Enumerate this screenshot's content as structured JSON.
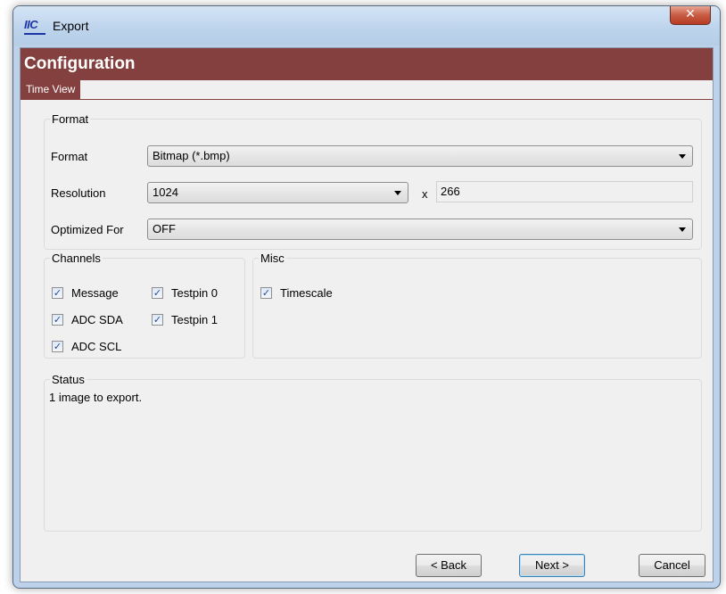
{
  "window": {
    "title": "Export",
    "app_icon_text": "IIC",
    "close_glyph": "✕"
  },
  "header": {
    "title": "Configuration",
    "tab": "Time View"
  },
  "format_group": {
    "legend": "Format",
    "format_label": "Format",
    "format_value": "Bitmap (*.bmp)",
    "resolution_label": "Resolution",
    "resolution_width": "1024",
    "resolution_sep": "x",
    "resolution_height": "266",
    "optimized_label": "Optimized For",
    "optimized_value": "OFF"
  },
  "channels_group": {
    "legend": "Channels",
    "items": [
      {
        "label": "Message",
        "checked": true
      },
      {
        "label": "Testpin 0",
        "checked": true
      },
      {
        "label": "ADC SDA",
        "checked": true
      },
      {
        "label": "Testpin 1",
        "checked": true
      },
      {
        "label": "ADC SCL",
        "checked": true
      }
    ]
  },
  "misc_group": {
    "legend": "Misc",
    "items": [
      {
        "label": "Timescale",
        "checked": true
      }
    ]
  },
  "status_group": {
    "legend": "Status",
    "text": "1 image to export."
  },
  "buttons": {
    "back": "< Back",
    "next": "Next >",
    "cancel": "Cancel"
  },
  "check_glyph": "✓",
  "colors": {
    "header": "#843f3f",
    "client_bg": "#f0f0f0",
    "frame": "#bcd2ea"
  }
}
